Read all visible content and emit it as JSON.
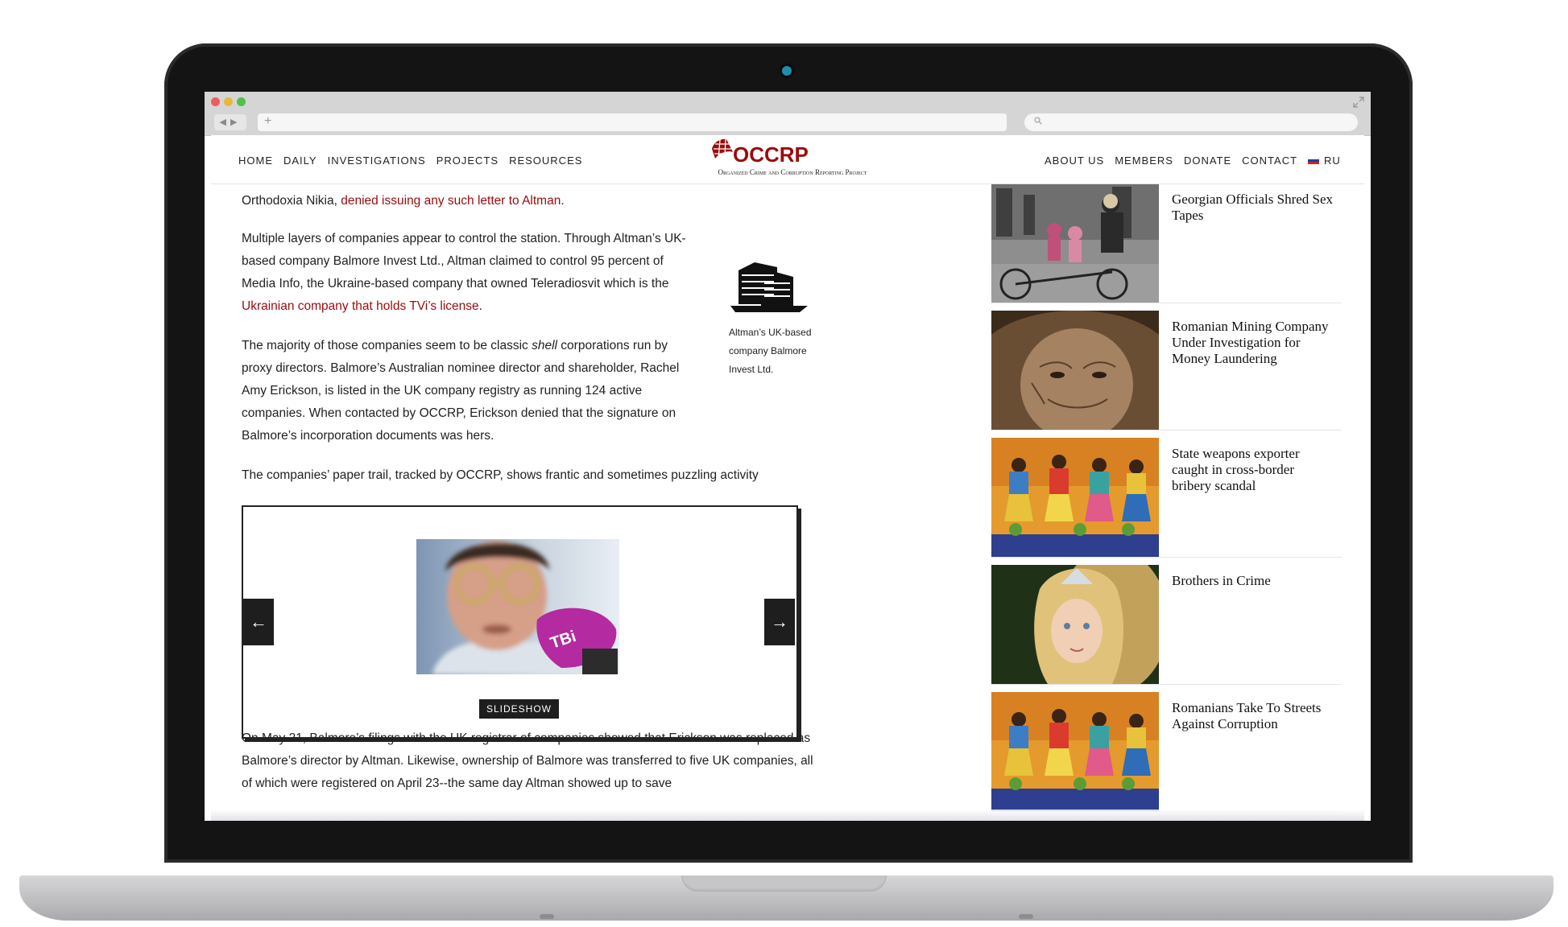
{
  "nav": {
    "left": [
      "HOME",
      "DAILY",
      "INVESTIGATIONS",
      "PROJECTS",
      "RESOURCES"
    ],
    "right": [
      "ABOUT US",
      "MEMBERS",
      "DONATE",
      "CONTACT"
    ],
    "lang": "RU"
  },
  "logo": {
    "name": "OCCRP",
    "tagline": "Organized Crime and Corruption Reporting Project"
  },
  "article": {
    "p1_before": "Orthodoxia Nikia, ",
    "p1_link": "denied issuing any such letter to Altman",
    "p1_after": ".",
    "p2_before": "Multiple layers of companies appear to control the station. Through Altman’s UK-based company Balmore Invest Ltd., Altman claimed to control 95 percent of Media Info, the Ukraine-based company that owned Teleradiosvit which is the ",
    "p2_link": "Ukrainian company that holds TVi’s license",
    "p2_after": ".",
    "p3_before": "The majority of those companies seem to be classic ",
    "p3_em": "shell",
    "p3_after": " corporations run by proxy directors. Balmore’s Australian nominee director and shareholder, Rachel Amy Erickson, is listed in the UK company registry as running 124 active companies. When contacted by OCCRP, Erickson denied that the signature on Balmore’s incorporation documents was hers.",
    "p4": "The companies’ paper trail, tracked by OCCRP, shows frantic and sometimes puzzling activity",
    "p5": "On May 21, Balmore’s filings with the UK registrar of companies showed that Erickson was replaced as Balmore’s director by Altman. Likewise, ownership of Balmore was transferred to five UK companies, all of which were registered on April 23--the same day Altman showed up to save",
    "factbox_caption": "Altman’s UK-based company Balmore Invest Ltd.",
    "slideshow_label": "SLIDESHOW",
    "mic_logo": "TBi"
  },
  "sidebar": {
    "items": [
      {
        "title": "Georgian Officials Shred Sex Tapes"
      },
      {
        "title": "Romanian Mining Company Under Investigation for Money Laundering"
      },
      {
        "title": "State weapons exporter caught in cross-border bribery scandal"
      },
      {
        "title": "Brothers in Crime"
      },
      {
        "title": "Romanians Take To Streets Against Corruption"
      }
    ]
  },
  "colors": {
    "brand": "#9b0b0b",
    "link": "#9b0b0b",
    "text": "#222222"
  }
}
